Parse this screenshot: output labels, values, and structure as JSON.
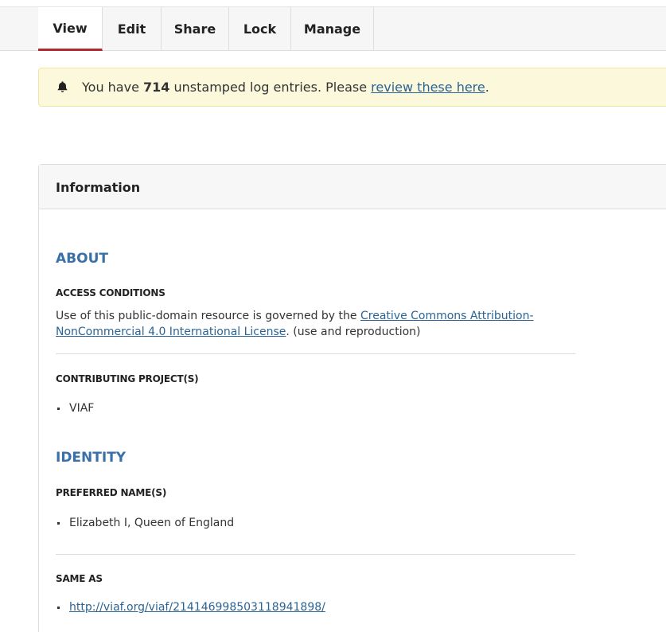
{
  "tabs": {
    "view": "View",
    "edit": "Edit",
    "share": "Share",
    "lock": "Lock",
    "manage": "Manage"
  },
  "alert": {
    "icon": "bell-icon",
    "prefix": "You have",
    "count": "714",
    "middle": "unstamped log entries. Please",
    "link_text": "review these here",
    "suffix": "."
  },
  "panel": {
    "title": "Information",
    "about": {
      "heading": "ABOUT",
      "access_label": "ACCESS CONDITIONS",
      "access_prefix": "Use of this public-domain resource is governed by the",
      "license_link": "Creative Commons Attribution-NonCommercial 4.0 International License",
      "access_suffix": ". (use and reproduction)",
      "contrib_label": "CONTRIBUTING PROJECT(S)",
      "contrib_items": [
        "VIAF"
      ]
    },
    "identity": {
      "heading": "IDENTITY",
      "preferred_label": "PREFERRED NAME(S)",
      "preferred_items": [
        "Elizabeth I, Queen of England"
      ],
      "sameas_label": "SAME AS",
      "sameas_items": [
        "http://viaf.org/viaf/214146998503118941898/"
      ]
    }
  },
  "colors": {
    "tab_active_underline": "#b02a30",
    "section_heading": "#3a70a8",
    "link": "#2a6496",
    "alert_bg": "#fcf8dc"
  }
}
